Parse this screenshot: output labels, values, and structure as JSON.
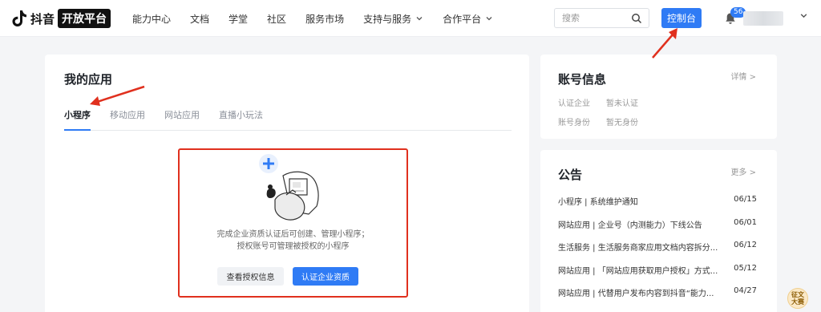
{
  "brand": {
    "name": "抖音",
    "badge": "开放平台"
  },
  "nav": [
    {
      "label": "能力中心",
      "dropdown": false
    },
    {
      "label": "文档",
      "dropdown": false
    },
    {
      "label": "学堂",
      "dropdown": false
    },
    {
      "label": "社区",
      "dropdown": false
    },
    {
      "label": "服务市场",
      "dropdown": false
    },
    {
      "label": "支持与服务",
      "dropdown": true
    },
    {
      "label": "合作平台",
      "dropdown": true
    }
  ],
  "search": {
    "placeholder": "搜索",
    "icon": "search-icon"
  },
  "header": {
    "console_label": "控制台",
    "notification_count": "56",
    "bell_icon": "bell-icon",
    "user_menu_icon": "chevron-down-icon"
  },
  "apps": {
    "title": "我的应用",
    "tabs": [
      "小程序",
      "移动应用",
      "网站应用",
      "直播小玩法"
    ],
    "active_tab": "小程序",
    "empty": {
      "line1": "完成企业资质认证后可创建、管理小程序；",
      "line2": "授权账号可管理被授权的小程序",
      "view_button": "查看授权信息",
      "certify_button": "认证企业资质"
    }
  },
  "account": {
    "title": "账号信息",
    "link": "详情 >",
    "rows": [
      {
        "key": "认证企业",
        "value": "暂未认证"
      },
      {
        "key": "账号身份",
        "value": "暂无身份"
      }
    ]
  },
  "notices": {
    "title": "公告",
    "link": "更多 >",
    "items": [
      {
        "title": "小程序 | 系统维护通知",
        "date": "06/15"
      },
      {
        "title": "网站应用 | 企业号（内测能力）下线公告",
        "date": "06/01"
      },
      {
        "title": "生活服务 | 生活服务商家应用文档内容拆分...",
        "date": "06/12"
      },
      {
        "title": "网站应用 | 「网站应用获取用户授权」方式...",
        "date": "05/12"
      },
      {
        "title": "网站应用 | 代替用户发布内容到抖音“能力...",
        "date": "04/27"
      }
    ]
  },
  "float_badge": {
    "line1": "征文",
    "line2": "大赛"
  },
  "colors": {
    "accent": "#2f7bf5",
    "highlight": "#e0301e",
    "background": "#f4f5f7"
  }
}
